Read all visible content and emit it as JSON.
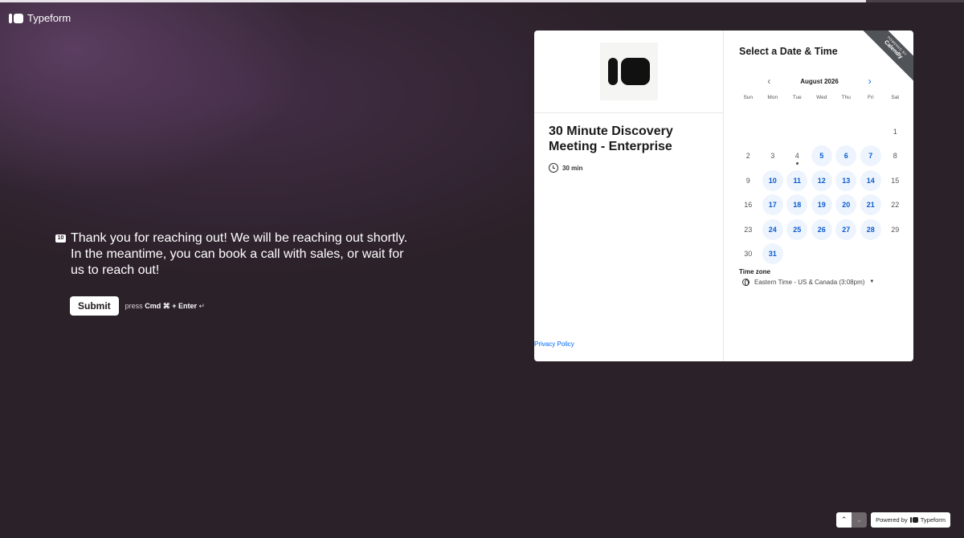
{
  "progress": {
    "fraction": 0.898
  },
  "brand": {
    "name": "Typeform"
  },
  "question": {
    "number": "10",
    "text": "Thank you for reaching out! We will be reaching out shortly. In the meantime, you can book a call with sales, or wait for us to reach out!",
    "submit_label": "Submit",
    "hint_prefix": "press",
    "hint_keys": "Cmd ⌘ + Enter",
    "hint_symbol": "↵"
  },
  "calendly": {
    "ribbon_small": "POWERED BY",
    "ribbon_big": "Calendly",
    "event_title": "30 Minute Discovery Meeting - Enterprise",
    "duration": "30 min",
    "privacy_label": "Privacy Policy",
    "heading": "Select a Date & Time",
    "month": "August 2026",
    "weekdays": [
      "Sun",
      "Mon",
      "Tue",
      "Wed",
      "Thu",
      "Fri",
      "Sat"
    ],
    "first_weekday_index": 6,
    "days_in_month": 31,
    "today": 4,
    "available_days": [
      5,
      6,
      7,
      10,
      11,
      12,
      13,
      14,
      17,
      18,
      19,
      20,
      21,
      24,
      25,
      26,
      27,
      28,
      31
    ],
    "timezone_label": "Time zone",
    "timezone_value": "Eastern Time - US & Canada (3:08pm)",
    "colors": {
      "accent": "#0069ff",
      "available_bg": "#eef4fd"
    }
  },
  "footer": {
    "powered_prefix": "Powered by",
    "powered_brand": "Typeform"
  }
}
